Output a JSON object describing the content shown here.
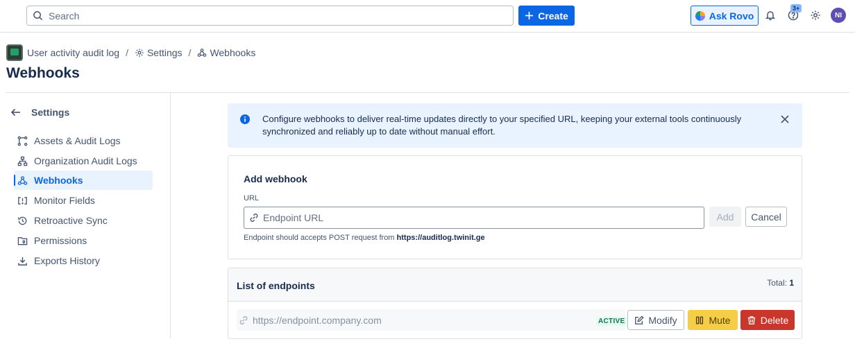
{
  "topbar": {
    "search_placeholder": "Search",
    "create_label": "Create",
    "ask_rovo_label": "Ask Rovo",
    "notifications_badge": "3+",
    "avatar_initials": "NI"
  },
  "breadcrumb": {
    "app_name": "User activity audit log",
    "settings": "Settings",
    "webhooks": "Webhooks"
  },
  "page": {
    "title": "Webhooks"
  },
  "sidebar": {
    "header": "Settings",
    "items": [
      {
        "label": "Assets & Audit Logs",
        "icon": "assets-icon"
      },
      {
        "label": "Organization Audit Logs",
        "icon": "org-tree-icon"
      },
      {
        "label": "Webhooks",
        "icon": "webhook-icon",
        "active": true
      },
      {
        "label": "Monitor Fields",
        "icon": "monitor-fields-icon"
      },
      {
        "label": "Retroactive Sync",
        "icon": "history-icon"
      },
      {
        "label": "Permissions",
        "icon": "permissions-icon"
      },
      {
        "label": "Exports History",
        "icon": "download-icon"
      }
    ]
  },
  "banner": {
    "text": "Configure webhooks to deliver real-time updates directly to your specified URL, keeping your external tools continuously synchronized and reliably up to date without manual effort."
  },
  "add_webhook": {
    "title": "Add webhook",
    "url_label": "URL",
    "url_placeholder": "Endpoint URL",
    "add_label": "Add",
    "cancel_label": "Cancel",
    "hint_prefix": "Endpoint should accepts POST request from",
    "hint_host": "https://auditlog.twinit.ge"
  },
  "endpoints": {
    "title": "List of endpoints",
    "total_label": "Total:",
    "total_value": "1",
    "items": [
      {
        "url": "https://endpoint.company.com",
        "status": "ACTIVE",
        "modify_label": "Modify",
        "mute_label": "Mute",
        "delete_label": "Delete"
      }
    ]
  },
  "colors": {
    "accent": "#0c66e4",
    "banner_bg": "#e9f2ff",
    "mute": "#f5cd47",
    "delete": "#c9372c",
    "status_active": "#216e4e"
  }
}
